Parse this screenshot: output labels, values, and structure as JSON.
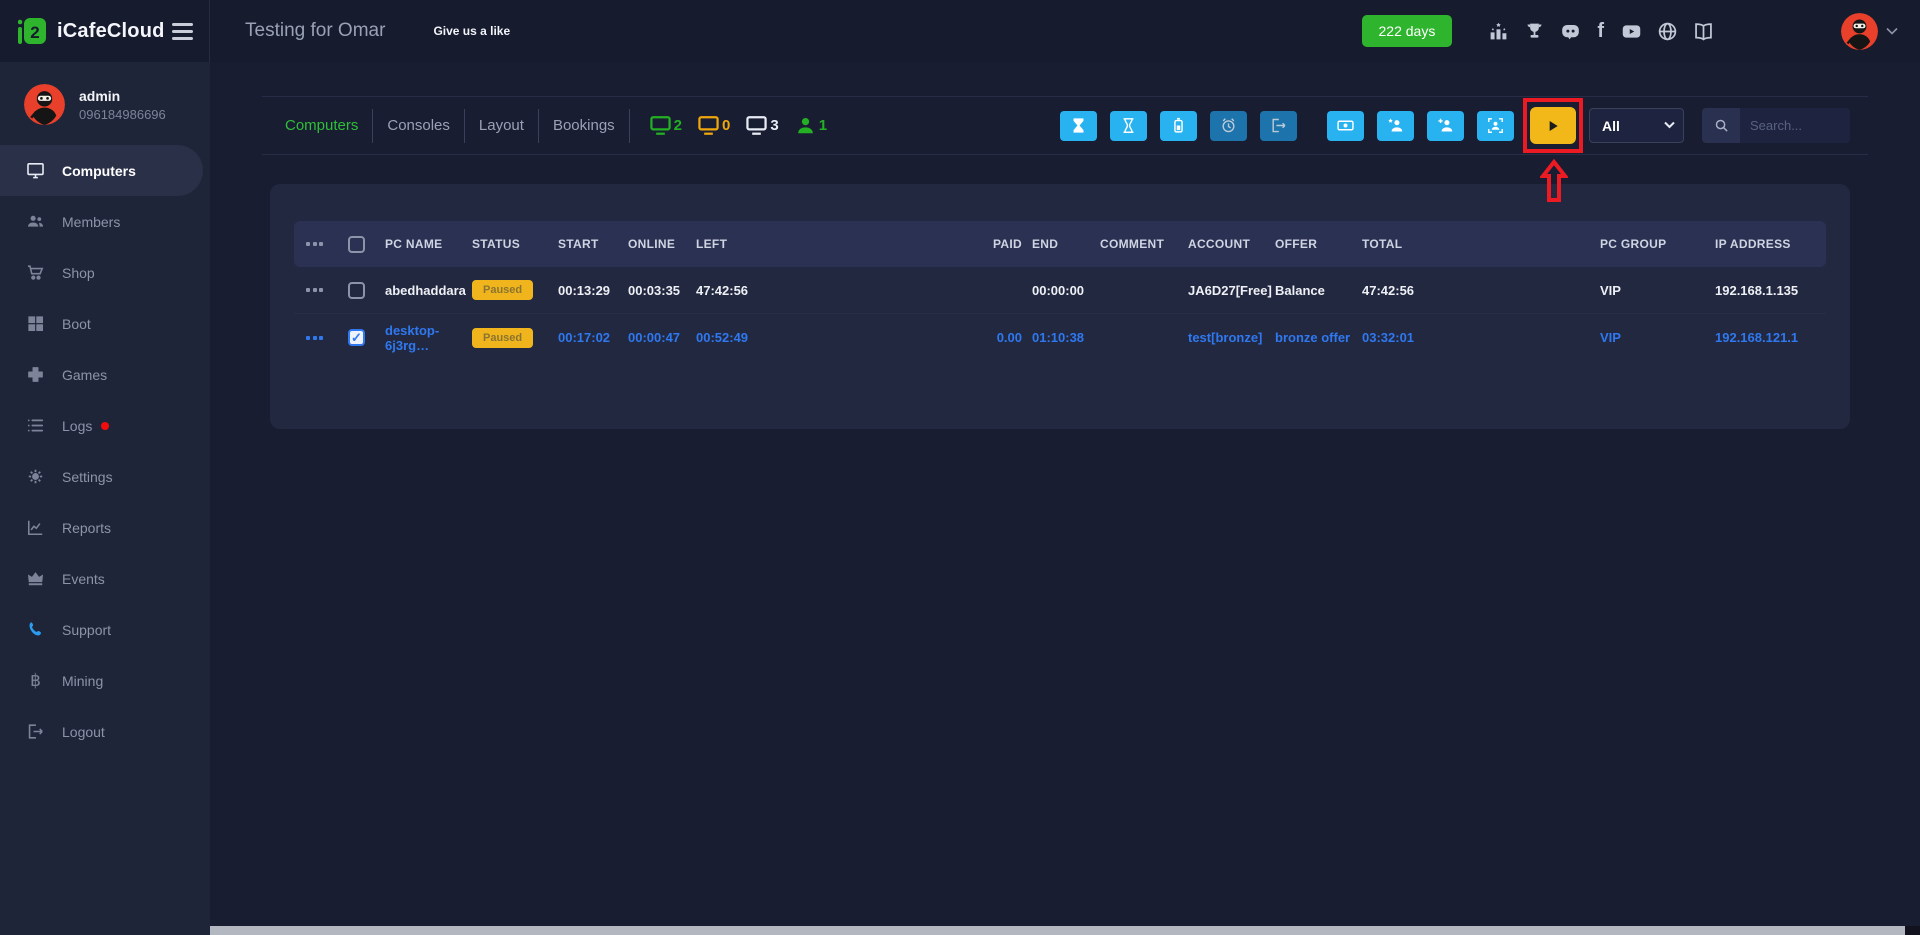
{
  "colors": {
    "accent_green": "#2eb52d",
    "tab_active_green": "#2fbe37",
    "action_blue": "#28b2f0",
    "action_disabled_blue": "#1d74ad",
    "play_yellow": "#f2b718",
    "badge_yellow": "#f0b41c",
    "annotation_red": "#ec1a23",
    "highlight_row_blue": "#2f78ef",
    "avatar_red": "#e8402a"
  },
  "topbar": {
    "brand": "iCafeCloud",
    "page_title": "Testing for Omar",
    "like_label": "Give us a like",
    "days_badge": "222 days",
    "icons": [
      "ranking-icon",
      "trophy-icon",
      "discord-icon",
      "facebook-icon",
      "youtube-icon",
      "globe-icon",
      "manual-icon"
    ]
  },
  "sidebar": {
    "user": {
      "name": "admin",
      "phone": "096184986696"
    },
    "items": [
      {
        "label": "Computers",
        "icon": "monitor-icon",
        "active": true
      },
      {
        "label": "Members",
        "icon": "users-icon"
      },
      {
        "label": "Shop",
        "icon": "cart-icon"
      },
      {
        "label": "Boot",
        "icon": "windows-icon"
      },
      {
        "label": "Games",
        "icon": "gamepad-icon"
      },
      {
        "label": "Logs",
        "icon": "list-icon",
        "notification_dot": true
      },
      {
        "label": "Settings",
        "icon": "gear-icon"
      },
      {
        "label": "Reports",
        "icon": "chart-icon"
      },
      {
        "label": "Events",
        "icon": "crown-icon"
      },
      {
        "label": "Support",
        "icon": "phone-icon"
      },
      {
        "label": "Mining",
        "icon": "bitcoin-icon"
      },
      {
        "label": "Logout",
        "icon": "logout-icon"
      }
    ]
  },
  "toolbar": {
    "tabs": [
      {
        "label": "Computers",
        "active": true
      },
      {
        "label": "Consoles"
      },
      {
        "label": "Layout"
      },
      {
        "label": "Bookings"
      }
    ],
    "counters": [
      {
        "icon": "monitor-icon",
        "value": "2",
        "color": "#23b123"
      },
      {
        "icon": "monitor-icon",
        "value": "0",
        "color": "#f0a70c"
      },
      {
        "icon": "monitor-icon",
        "value": "3",
        "color": "#e8ecf4"
      },
      {
        "icon": "member-icon",
        "value": "1",
        "color": "#23b123"
      }
    ],
    "actions": [
      {
        "icon": "hourglass-filled-icon",
        "enabled": true
      },
      {
        "icon": "hourglass-outline-icon",
        "enabled": true
      },
      {
        "icon": "battery-icon",
        "enabled": true
      },
      {
        "icon": "alarm-icon",
        "enabled": false
      },
      {
        "icon": "sign-out-icon",
        "enabled": false
      },
      {
        "icon": "cash-icon",
        "enabled": true
      },
      {
        "icon": "guest-account-icon",
        "enabled": true
      },
      {
        "icon": "add-account-icon",
        "enabled": true
      },
      {
        "icon": "scan-account-icon",
        "enabled": true
      },
      {
        "icon": "play-icon",
        "enabled": true,
        "annotated": true
      }
    ],
    "filter_value": "All",
    "search_placeholder": "Search..."
  },
  "table": {
    "headers": [
      "PC NAME",
      "STATUS",
      "START",
      "ONLINE",
      "LEFT",
      "PAID",
      "END",
      "COMMENT",
      "ACCOUNT",
      "OFFER",
      "TOTAL",
      "PC GROUP",
      "IP ADDRESS"
    ],
    "rows": [
      {
        "checked": false,
        "highlighted": false,
        "pc_name": "abedhaddara",
        "status": "Paused",
        "start": "00:13:29",
        "online": "00:03:35",
        "left": "47:42:56",
        "paid": "",
        "end": "00:00:00",
        "comment": "",
        "account": "JA6D27[Free]",
        "offer": "Balance",
        "total": "47:42:56",
        "pc_group": "VIP",
        "ip_address": "192.168.1.135"
      },
      {
        "checked": true,
        "highlighted": true,
        "pc_name": "desktop-6j3rg…",
        "status": "Paused",
        "start": "00:17:02",
        "online": "00:00:47",
        "left": "00:52:49",
        "paid": "0.00",
        "end": "01:10:38",
        "comment": "",
        "account": "test[bronze]",
        "offer": "bronze offer",
        "total": "03:32:01",
        "pc_group": "VIP",
        "ip_address": "192.168.121.1"
      }
    ]
  }
}
